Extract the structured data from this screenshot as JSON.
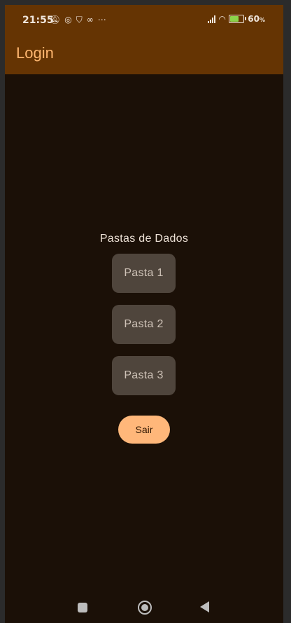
{
  "status_bar": {
    "time": "21:55",
    "battery": "60",
    "battery_unit": "%",
    "battery_level": 0.6,
    "left_icons": [
      "muted-bell-icon",
      "whatsapp-icon",
      "shield-icon",
      "mask-icon",
      "more-icon"
    ],
    "right_icons": [
      "signal-icon",
      "wifi-icon",
      "battery-icon"
    ]
  },
  "app_bar": {
    "title": "Login"
  },
  "main": {
    "heading": "Pastas de Dados",
    "folders": [
      {
        "label": "Pasta 1"
      },
      {
        "label": "Pasta 2"
      },
      {
        "label": "Pasta 3"
      }
    ],
    "exit_label": "Sair"
  },
  "colors": {
    "app_bar": "#653403",
    "background": "#1b1007",
    "title": "#ffb66f",
    "folder_button": "#4f453c",
    "exit_button": "#ffb77a"
  }
}
